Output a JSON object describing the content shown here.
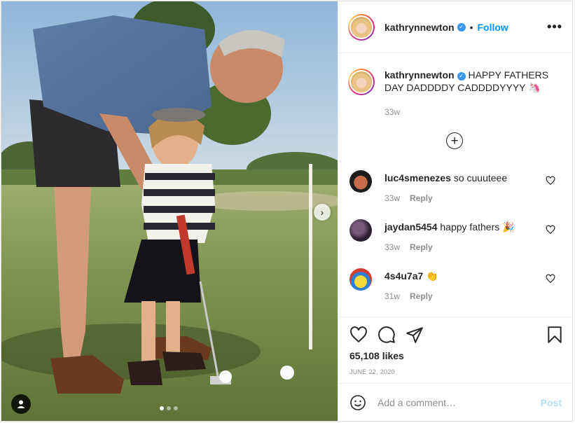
{
  "post": {
    "username": "kathrynnewton",
    "follow_label": "Follow",
    "separator": "•",
    "more_label": "•••",
    "next_arrow": "›",
    "verified_icon": "✓",
    "caption_text": "HAPPY FATHERS DAY DADDDDY CADDDDYYYY 🦄",
    "caption_time": "33w",
    "load_more": "+",
    "carousel_count": 3,
    "carousel_active_index": 0
  },
  "comments": [
    {
      "username": "luc4smenezes",
      "text": "so cuuuteee",
      "time": "33w",
      "reply": "Reply",
      "avatar_color": "#7a2f1e"
    },
    {
      "username": "jaydan5454",
      "text": "happy fathers 🎉",
      "time": "33w",
      "reply": "Reply",
      "avatar_color": "#3a2a3c"
    },
    {
      "username": "4s4u7a7",
      "text": "👏",
      "time": "31w",
      "reply": "Reply",
      "avatar_color": "#f2d93b"
    }
  ],
  "actions": {
    "likes": "65,108 likes",
    "date": "JUNE 22, 2020",
    "icons": [
      "heart-icon",
      "comment-icon",
      "share-icon",
      "bookmark-icon"
    ]
  },
  "add_comment": {
    "placeholder": "Add a comment…",
    "post_label": "Post",
    "emoji_icon": "smiley-icon"
  },
  "colors": {
    "accent": "#0095f6",
    "verified": "#3897f0",
    "muted": "#8e8e8e",
    "post_disabled": "#b2dffc"
  }
}
